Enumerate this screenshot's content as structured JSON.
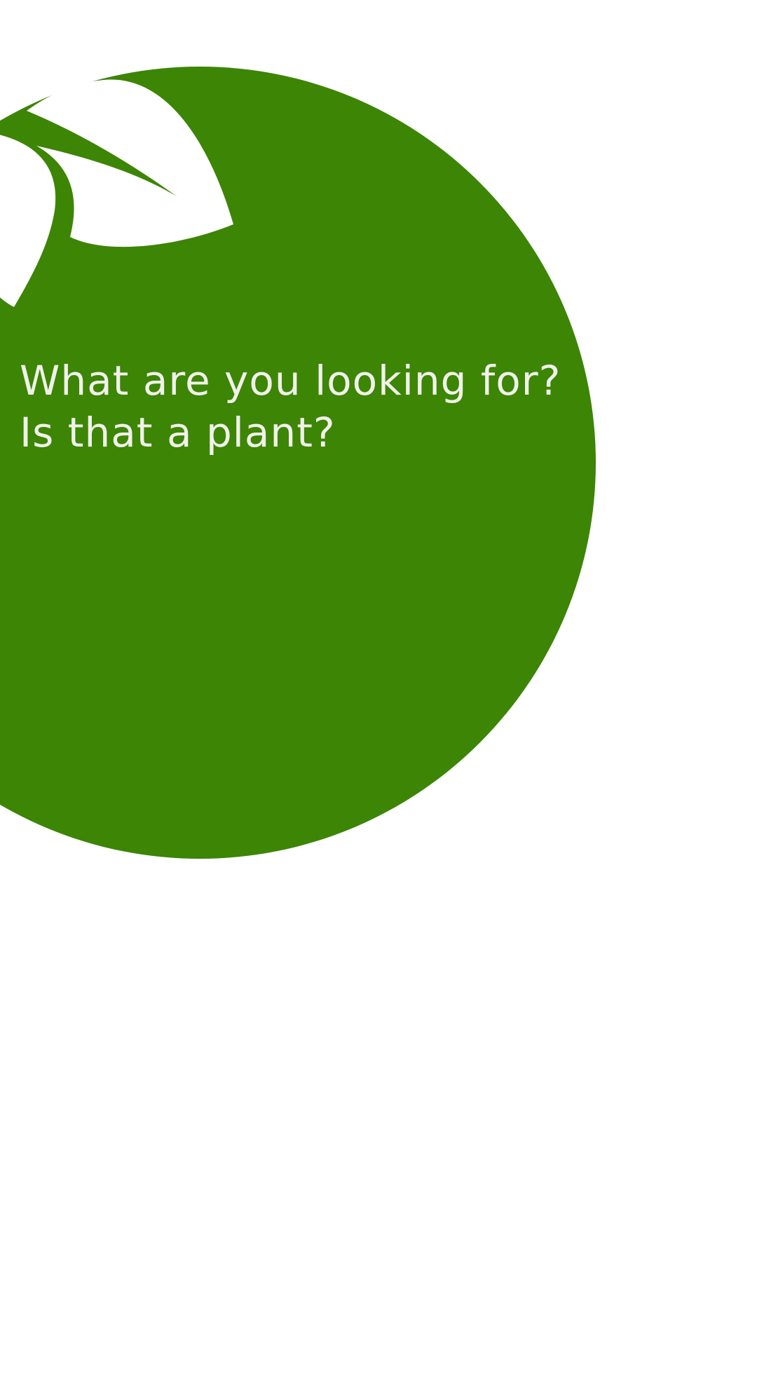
{
  "welcome": {
    "logo_icon": "leaf-icon",
    "headline_line1": "What are you looking for?",
    "headline_line2": "Is that a plant?"
  },
  "colors": {
    "background": "#ffffff",
    "accent_green": "#3c8505",
    "text_light": "#f1f1ea"
  }
}
